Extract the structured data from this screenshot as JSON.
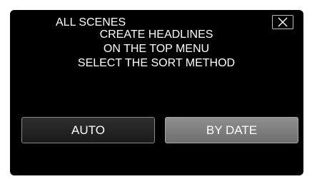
{
  "dialog": {
    "title": "ALL SCENES",
    "message_lines": [
      "CREATE HEADLINES",
      "ON THE TOP MENU",
      "SELECT THE SORT METHOD"
    ]
  },
  "buttons": {
    "auto_label": "AUTO",
    "by_date_label": "BY DATE"
  },
  "icons": {
    "close": "close-icon"
  },
  "colors": {
    "background": "#000000",
    "text": "#ffffff",
    "selected_button": "#7f7f7f"
  }
}
